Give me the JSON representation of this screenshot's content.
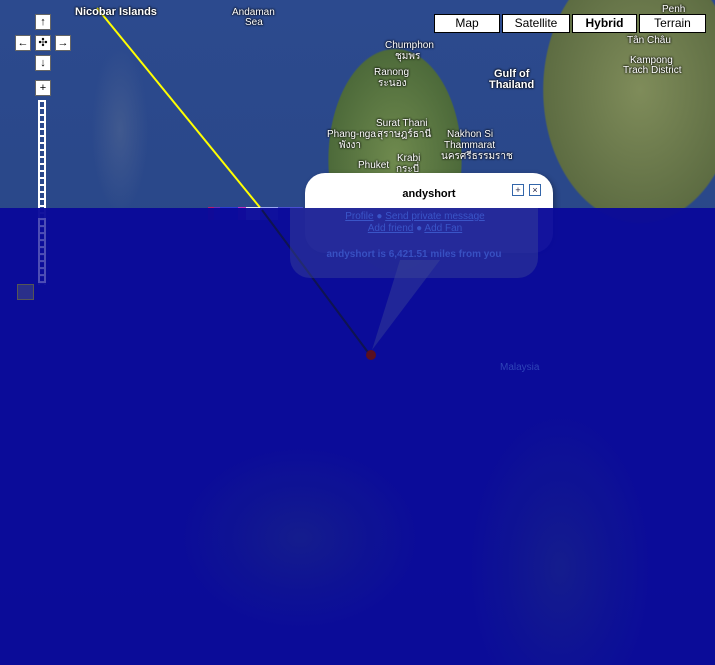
{
  "map_types": {
    "map": "Map",
    "satellite": "Satellite",
    "hybrid": "Hybrid",
    "terrain": "Terrain",
    "selected": "Hybrid"
  },
  "nav": {
    "up": "↑",
    "down": "↓",
    "left": "←",
    "right": "→",
    "center": "✣",
    "zoom_in": "+"
  },
  "places": {
    "nicobar": "Nicobar Islands",
    "andaman_1": "Andaman",
    "andaman_2": "Sea",
    "chumphon": "Chumphon",
    "chumphon_th": "ชุมพร",
    "ranong": "Ranong",
    "ranong_th": "ระนอง",
    "gulf_1": "Gulf of",
    "gulf_2": "Thailand",
    "surat": "Surat Thani",
    "surat_th": "สุราษฎร์ธานี",
    "phangnga": "Phang-nga",
    "phangnga_th": "พังงา",
    "nakhon_1": "Nakhon Si",
    "nakhon_2": "Thammarat",
    "nakhon_th": "นครศรีธรรมราช",
    "krabi": "Krabi",
    "krabi_th": "กระบี่",
    "phuket": "Phuket",
    "penh": "Penh",
    "tanchau": "Tân Châu",
    "kampong_1": "Kampong",
    "kampong_2": "Trach District",
    "malaysia": "Malaysia"
  },
  "infowindow": {
    "title": "andyshort",
    "links": [
      "Profile",
      "Send private message",
      "Add friend",
      "Add Fan"
    ],
    "distance": "andyshort is 6,421.51 miles from you"
  },
  "accent": "#ffff00"
}
